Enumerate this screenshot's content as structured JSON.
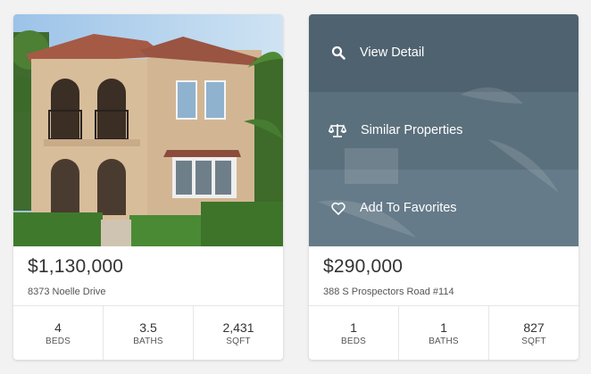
{
  "listings": [
    {
      "price": "$1,130,000",
      "address": "8373 Noelle Drive",
      "stats": [
        {
          "value": "4",
          "label": "BEDS"
        },
        {
          "value": "3.5",
          "label": "BATHS"
        },
        {
          "value": "2,431",
          "label": "SQFT"
        }
      ]
    },
    {
      "price": "$290,000",
      "address": "388 S Prospectors Road #114",
      "actions": [
        {
          "label": "View Detail",
          "icon": "search-icon"
        },
        {
          "label": "Similar Properties",
          "icon": "scale-icon"
        },
        {
          "label": "Add To Favorites",
          "icon": "heart-icon"
        }
      ],
      "stats": [
        {
          "value": "1",
          "label": "BEDS"
        },
        {
          "value": "1",
          "label": "BATHS"
        },
        {
          "value": "827",
          "label": "SQFT"
        }
      ]
    }
  ],
  "colors": {
    "overlay_top": "#4f6270",
    "overlay_mid": "#5a6f7c",
    "overlay_bottom": "#647a88",
    "background": "#f2f2f2"
  }
}
